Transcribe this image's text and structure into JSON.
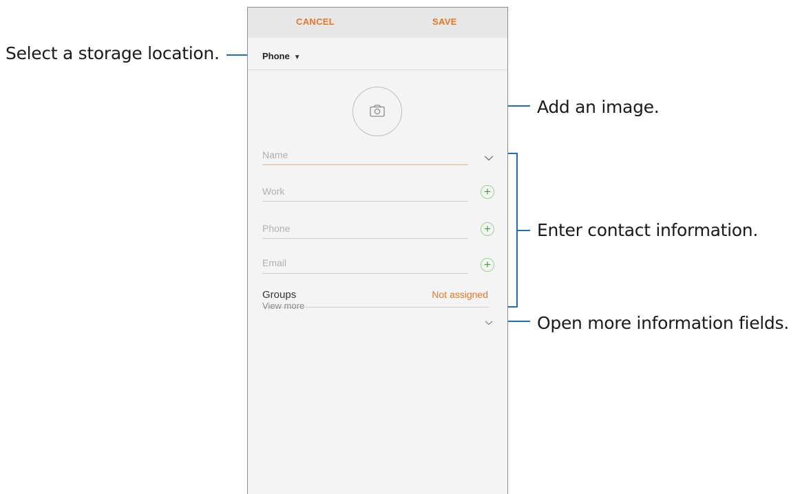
{
  "callouts": {
    "storage": "Select a storage location.",
    "image": "Add an image.",
    "contact": "Enter contact information.",
    "more": "Open more information fields."
  },
  "toolbar": {
    "cancel_label": "CANCEL",
    "save_label": "SAVE"
  },
  "storage": {
    "selected": "Phone"
  },
  "fields": {
    "name": "Name",
    "work": "Work",
    "phone": "Phone",
    "email": "Email"
  },
  "groups": {
    "label": "Groups",
    "value": "Not assigned"
  },
  "view_more": "View more",
  "colors": {
    "accent": "#e87722",
    "callout_line": "#1f6db5",
    "add_icon": "#3ea52a"
  },
  "icons": [
    "camera-icon",
    "chevron-down-icon",
    "plus-icon",
    "caret-down-icon"
  ]
}
